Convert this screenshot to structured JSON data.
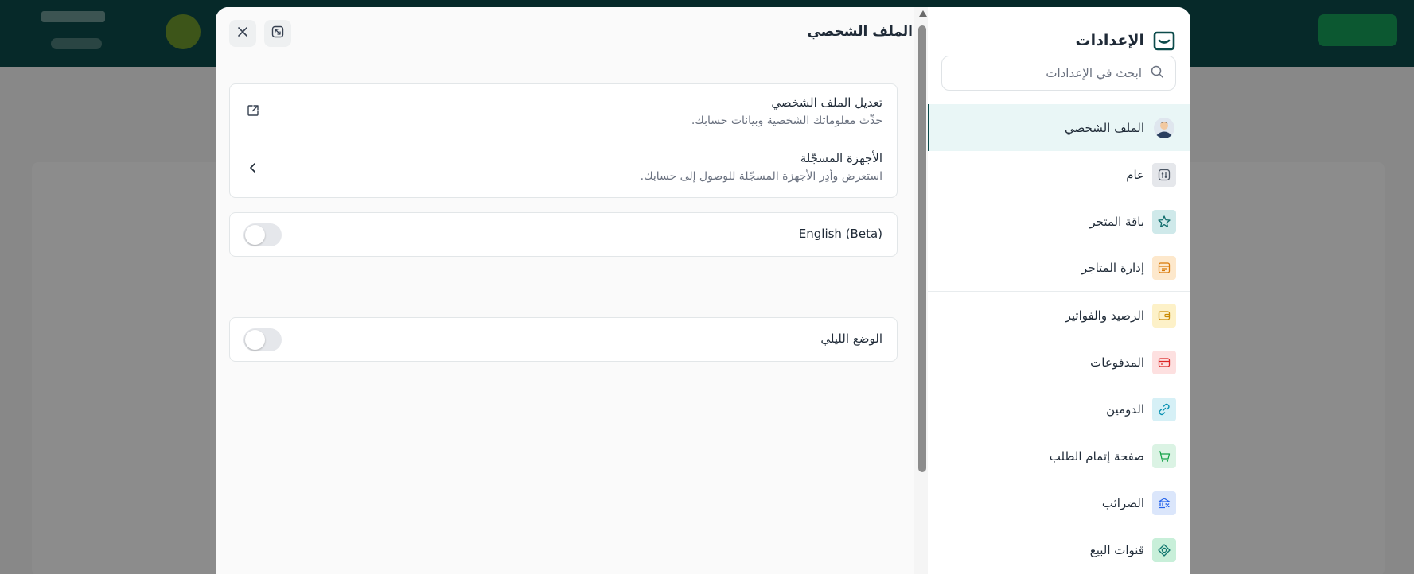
{
  "settings": {
    "title": "الإعدادات",
    "search_placeholder": "ابحث في الإعدادات",
    "items": [
      {
        "label": "الملف الشخصي",
        "icon": "user-avatar-icon",
        "color": "#e9f6f6",
        "active": true
      },
      {
        "label": "عام",
        "icon": "sliders-icon",
        "color": "#e5e7eb"
      },
      {
        "label": "باقة المتجر",
        "icon": "star-icon",
        "color": "#cfe9ea"
      },
      {
        "label": "إدارة المتاجر",
        "icon": "store-icon",
        "color": "#fde8cc"
      },
      {
        "label": "الرصيد والفواتير",
        "icon": "wallet-icon",
        "color": "#fdf1c8"
      },
      {
        "label": "المدفوعات",
        "icon": "credit-card-icon",
        "color": "#fde0e0"
      },
      {
        "label": "الدومين",
        "icon": "link-icon",
        "color": "#d6f0f6"
      },
      {
        "label": "صفحة إتمام الطلب",
        "icon": "cart-icon",
        "color": "#dbf3e4"
      },
      {
        "label": "الضرائب",
        "icon": "bank-tax-icon",
        "color": "#dbe6fb"
      },
      {
        "label": "قنوات البيع",
        "icon": "channels-icon",
        "color": "#c8efd9"
      }
    ]
  },
  "panel": {
    "title": "الملف الشخصي",
    "edit_profile": {
      "title": "تعديل الملف الشخصي",
      "description": "حدِّث معلوماتك الشخصية وبيانات حسابك."
    },
    "devices": {
      "title": "الأجهزة المسجّلة",
      "description": "استعرض وأدِر الأجهزة المسجّلة للوصول إلى حسابك."
    },
    "english_toggle": {
      "label": "English (Beta)",
      "enabled": false
    },
    "dark_mode_toggle": {
      "label": "الوضع الليلي",
      "enabled": false
    }
  }
}
